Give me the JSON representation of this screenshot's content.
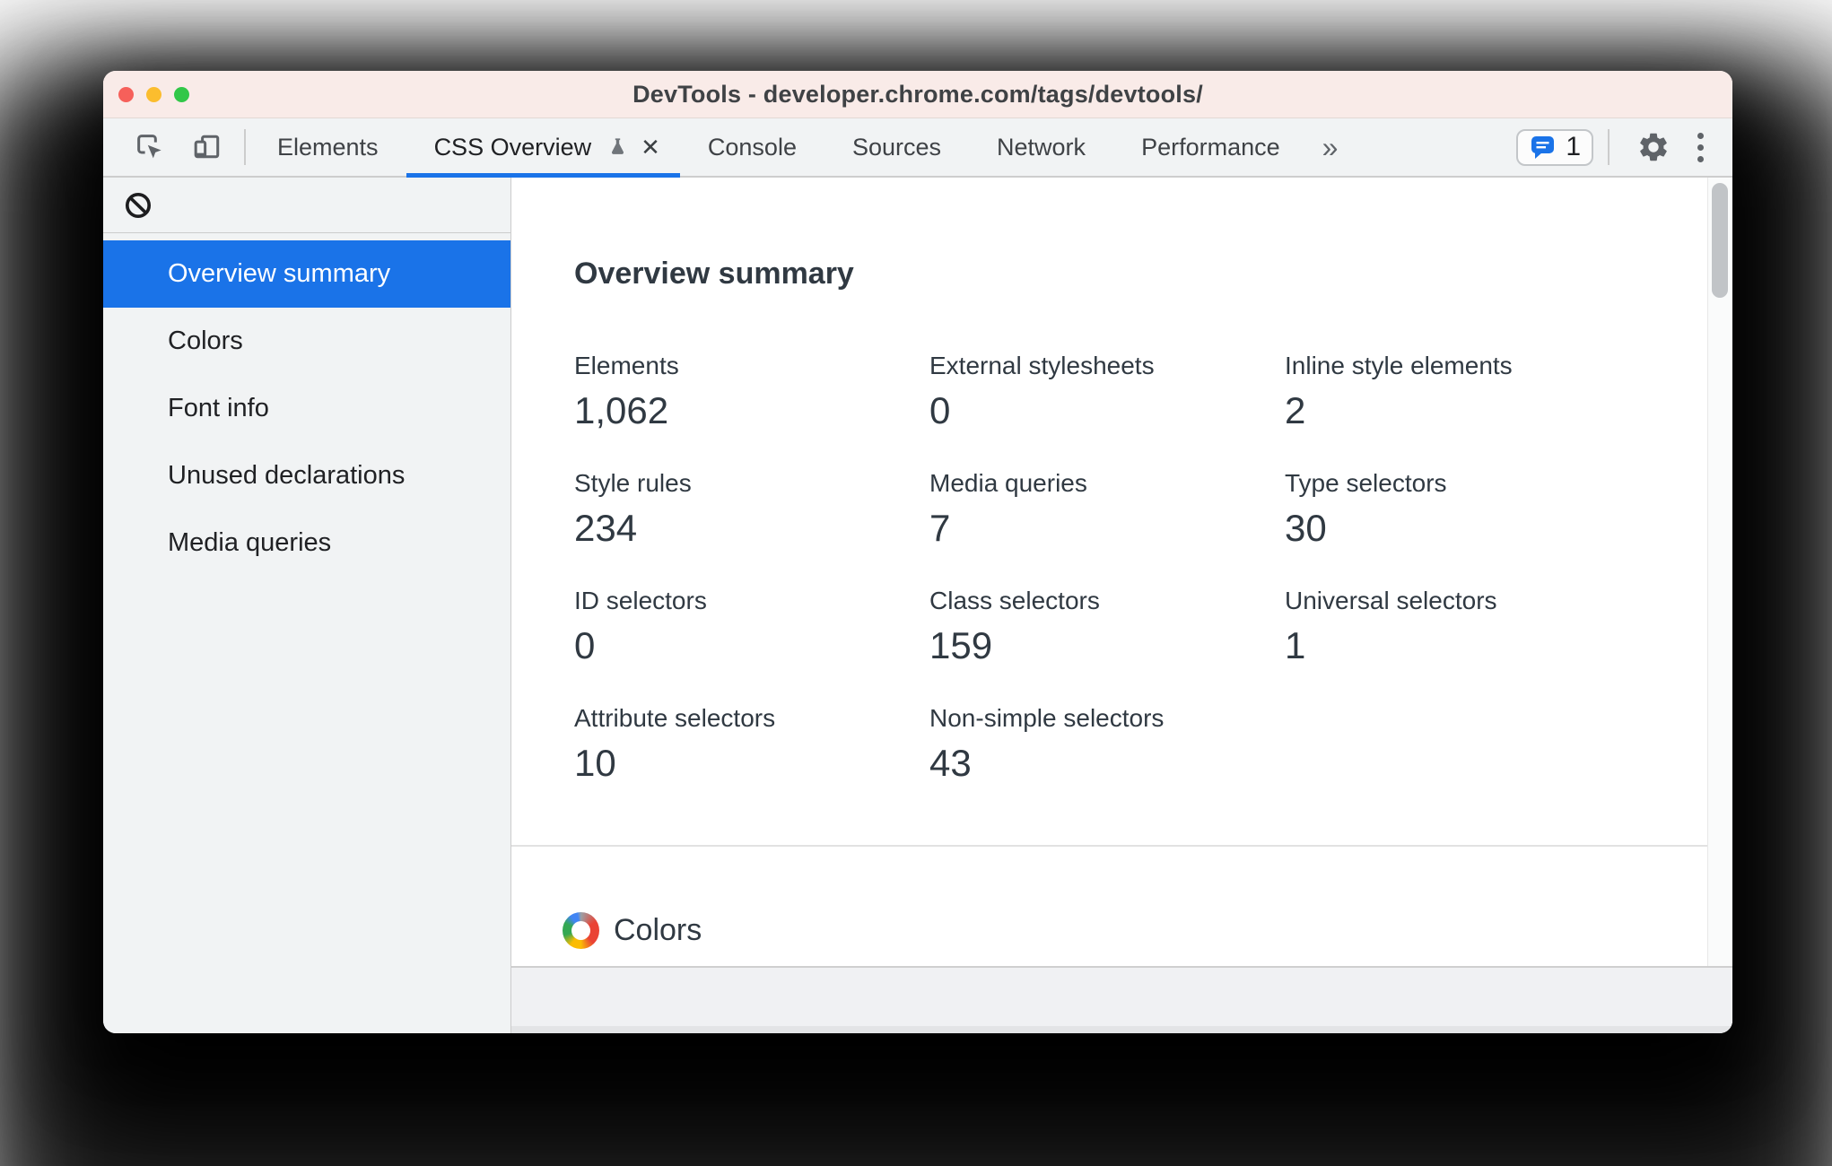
{
  "window": {
    "title": "DevTools - developer.chrome.com/tags/devtools/"
  },
  "tabbar": {
    "tabs": [
      {
        "label": "Elements"
      },
      {
        "label": "CSS Overview",
        "active": true
      },
      {
        "label": "Console"
      },
      {
        "label": "Sources"
      },
      {
        "label": "Network"
      },
      {
        "label": "Performance"
      }
    ],
    "overflow_label": "»",
    "chat_count": "1"
  },
  "sidebar": {
    "items": [
      {
        "label": "Overview summary",
        "selected": true
      },
      {
        "label": "Colors"
      },
      {
        "label": "Font info"
      },
      {
        "label": "Unused declarations"
      },
      {
        "label": "Media queries"
      }
    ]
  },
  "content": {
    "heading": "Overview summary",
    "stats": [
      {
        "label": "Elements",
        "value": "1,062"
      },
      {
        "label": "External stylesheets",
        "value": "0"
      },
      {
        "label": "Inline style elements",
        "value": "2"
      },
      {
        "label": "Style rules",
        "value": "234"
      },
      {
        "label": "Media queries",
        "value": "7"
      },
      {
        "label": "Type selectors",
        "value": "30"
      },
      {
        "label": "ID selectors",
        "value": "0"
      },
      {
        "label": "Class selectors",
        "value": "159"
      },
      {
        "label": "Universal selectors",
        "value": "1"
      },
      {
        "label": "Attribute selectors",
        "value": "10"
      },
      {
        "label": "Non-simple selectors",
        "value": "43"
      }
    ],
    "colors_section_title": "Colors"
  },
  "colors": {
    "accent_blue": "#1a73e8",
    "titlebar_pink": "#f9ebe8",
    "toolbar_gray": "#f1f3f4",
    "text_dark": "#303942",
    "icon_gray": "#5f6368"
  }
}
